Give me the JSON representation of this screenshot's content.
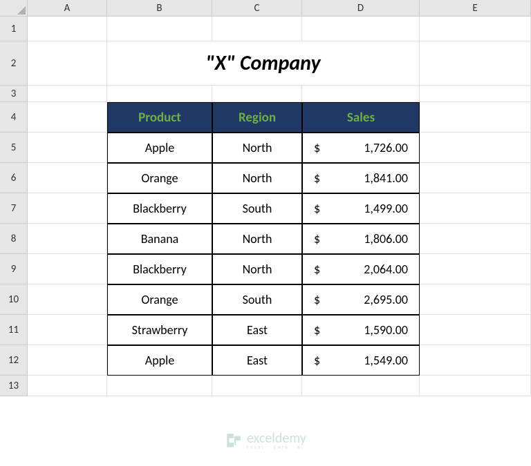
{
  "columns": [
    "A",
    "B",
    "C",
    "D",
    "E"
  ],
  "rows": [
    "1",
    "2",
    "3",
    "4",
    "5",
    "6",
    "7",
    "8",
    "9",
    "10",
    "11",
    "12",
    "13"
  ],
  "title": "\"X\" Company",
  "headers": {
    "product": "Product",
    "region": "Region",
    "sales": "Sales"
  },
  "currency": "$",
  "data": [
    {
      "product": "Apple",
      "region": "North",
      "sales": "1,726.00"
    },
    {
      "product": "Orange",
      "region": "North",
      "sales": "1,841.00"
    },
    {
      "product": "Blackberry",
      "region": "South",
      "sales": "1,499.00"
    },
    {
      "product": "Banana",
      "region": "North",
      "sales": "1,806.00"
    },
    {
      "product": "Blackberry",
      "region": "North",
      "sales": "2,064.00"
    },
    {
      "product": "Orange",
      "region": "South",
      "sales": "2,695.00"
    },
    {
      "product": "Strawberry",
      "region": "East",
      "sales": "1,590.00"
    },
    {
      "product": "Apple",
      "region": "East",
      "sales": "1,549.00"
    }
  ],
  "watermark": {
    "main": "exceldemy",
    "sub": "EXCEL · DATA · BI"
  }
}
